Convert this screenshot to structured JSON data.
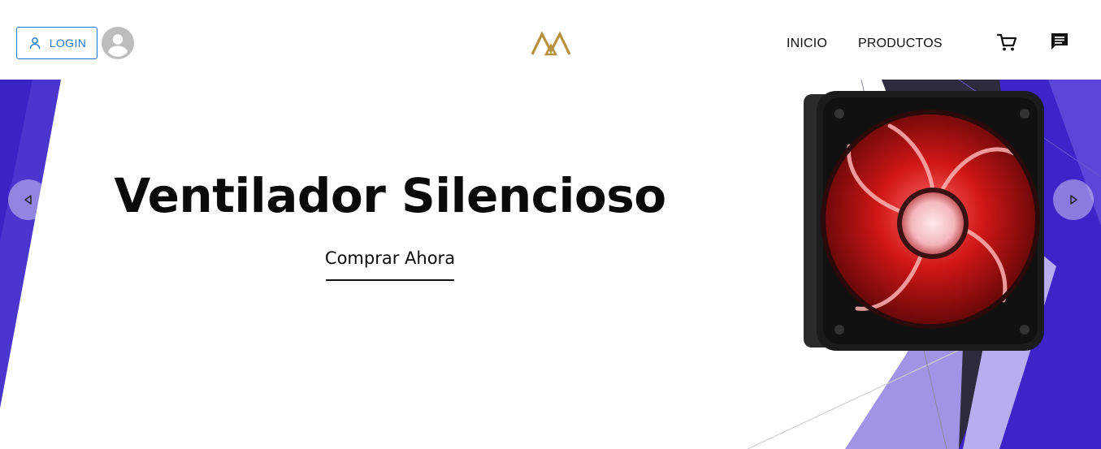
{
  "header": {
    "login_label": "LOGIN",
    "nav": [
      {
        "label": "INICIO"
      },
      {
        "label": "PRODUCTOS"
      }
    ],
    "icons": {
      "user": "user-outline-icon",
      "avatar": "account-circle-icon",
      "logo": "brand-logo",
      "cart": "shopping-cart-icon",
      "chat": "chat-message-icon"
    }
  },
  "hero": {
    "title": "Ventilador Silencioso",
    "cta_label": "Comprar Ahora",
    "image": "red-led-case-fan",
    "controls": {
      "prev": "triangle-left-icon",
      "next": "triangle-right-icon"
    }
  },
  "colors": {
    "accent": "#1976d2",
    "logo_gold": "#b8913f",
    "hero_purple": "#3f2ad0",
    "hero_lilac": "#9f94e6",
    "hero_dark": "#2d2b3c"
  }
}
